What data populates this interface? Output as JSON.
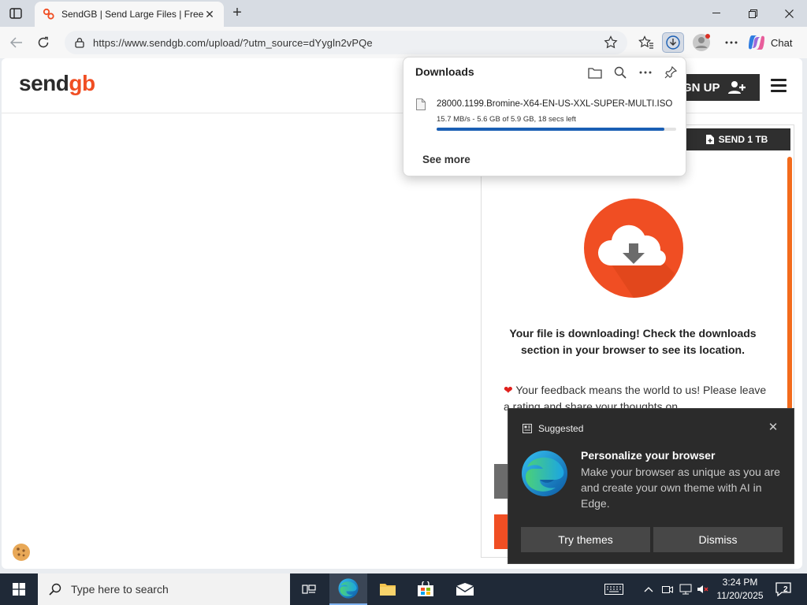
{
  "browser": {
    "tab_title": "SendGB | Send Large Files | Free f",
    "url": "https://www.sendgb.com/upload/?utm_source=dYygln2vPQe",
    "chat_label": "Chat"
  },
  "site": {
    "logo_main": "send",
    "logo_accent": "gb",
    "signup_label": "GN UP",
    "send_label": "SEND 1 TB",
    "download_message": "Your file is downloading! Check the downloads section in your browser to see its location.",
    "feedback_text": "Your feedback means the world to us! Please leave a rating and share your thoughts on"
  },
  "downloads": {
    "title": "Downloads",
    "file_name": "28000.1199.Bromine-X64-EN-US-XXL-SUPER-MULTI.ISO",
    "status": "15.7 MB/s - 5.6 GB of 5.9 GB, 18 secs left",
    "progress": 0.95,
    "see_more": "See more"
  },
  "suggestion": {
    "header": "Suggested",
    "title": "Personalize your browser",
    "body": "Make your browser as unique as you are and create your own theme with AI in Edge.",
    "primary": "Try themes",
    "secondary": "Dismiss"
  },
  "taskbar": {
    "search_placeholder": "Type here to search",
    "time": "3:24 PM",
    "date": "11/20/2025",
    "notification_count": "2"
  },
  "colors": {
    "brand": "#f04e23",
    "progress": "#1a5fb4",
    "dark_button": "#2f2f2f"
  }
}
